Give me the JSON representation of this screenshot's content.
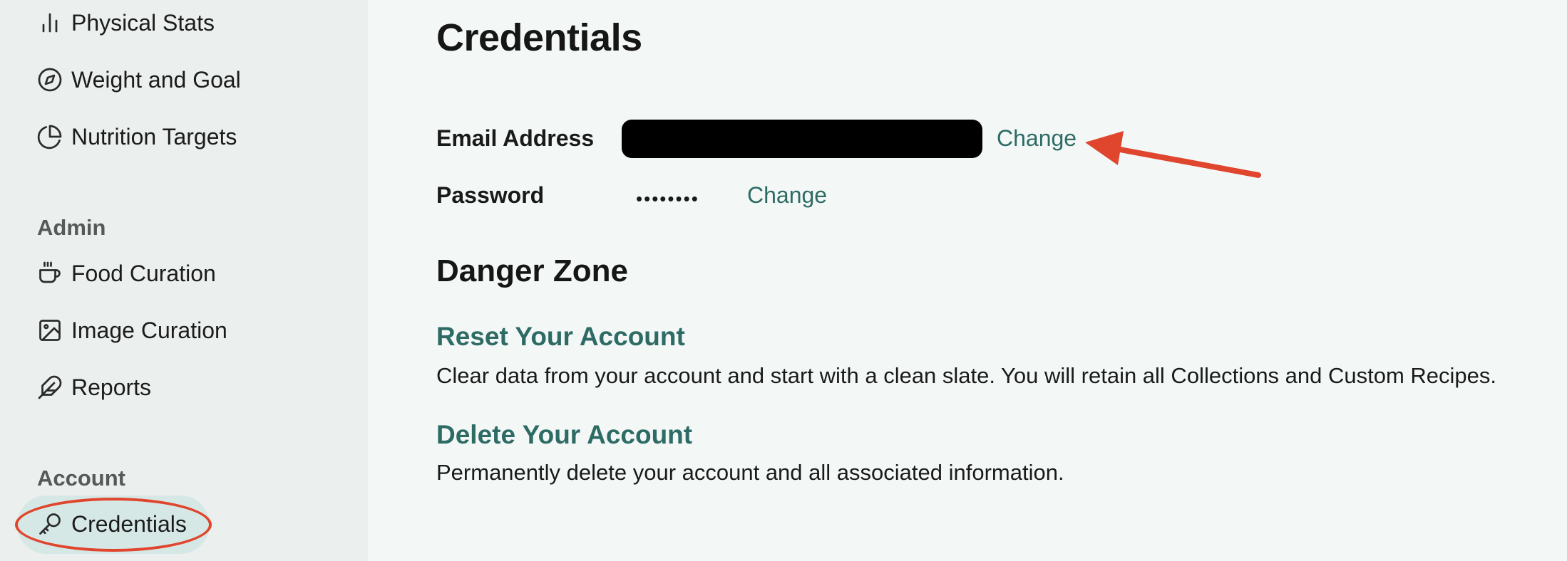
{
  "sidebar": {
    "items_top": [
      {
        "label": "Physical Stats",
        "icon": "bar-chart-icon"
      },
      {
        "label": "Weight and Goal",
        "icon": "compass-icon"
      },
      {
        "label": "Nutrition Targets",
        "icon": "pie-chart-icon"
      }
    ],
    "admin": {
      "heading": "Admin",
      "items": [
        {
          "label": "Food Curation",
          "icon": "coffee-cup-icon"
        },
        {
          "label": "Image Curation",
          "icon": "image-icon"
        },
        {
          "label": "Reports",
          "icon": "feather-icon"
        }
      ]
    },
    "account": {
      "heading": "Account",
      "items": [
        {
          "label": "Credentials",
          "icon": "key-icon",
          "active": true
        }
      ]
    }
  },
  "main": {
    "title": "Credentials",
    "email": {
      "label": "Email Address",
      "change_label": "Change"
    },
    "password": {
      "label": "Password",
      "masked_value": "••••••••",
      "change_label": "Change"
    },
    "danger_zone": {
      "heading": "Danger Zone",
      "reset": {
        "title": "Reset Your Account",
        "description": "Clear data from your account and start with a clean slate. You will retain all Collections and Custom Recipes."
      },
      "delete": {
        "title": "Delete Your Account",
        "description": "Permanently delete your account and all associated information."
      }
    }
  },
  "colors": {
    "accent": "#2e6b65",
    "sidebar_bg": "#ebefee",
    "main_bg": "#f3f8f7",
    "active_pill": "#d6e8e5",
    "annotation": "#e0452d"
  }
}
